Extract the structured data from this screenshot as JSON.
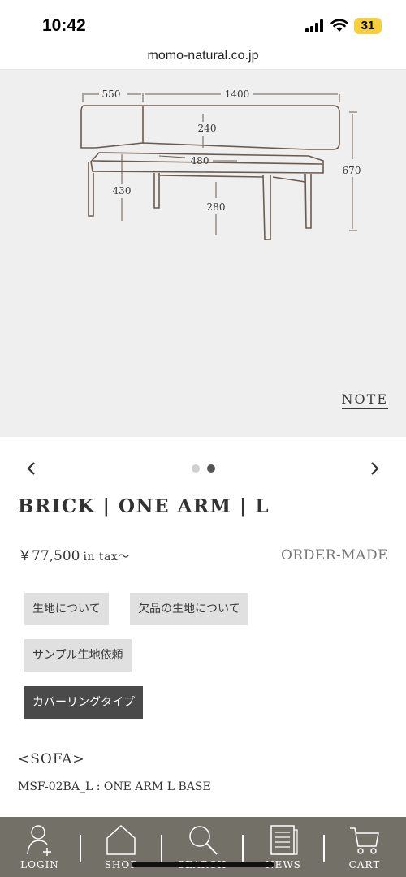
{
  "status": {
    "time": "10:42",
    "battery": "31"
  },
  "browser": {
    "url": "momo-natural.co.jp"
  },
  "dimensions": {
    "arm_width": "550",
    "total_width": "1400",
    "back_height": "240",
    "seat_depth": "480",
    "total_height": "670",
    "seat_height": "430",
    "leg_height": "280"
  },
  "note_link": "NOTE",
  "carousel": {
    "total_slides": 2,
    "active_slide": 2
  },
  "product": {
    "title": "BRICK | ONE ARM | L",
    "price": "￥77,500",
    "price_suffix": "in tax～",
    "order_type": "ORDER-MADE"
  },
  "buttons": {
    "fabric_info": "生地について",
    "missing_fabric": "欠品の生地について",
    "sample_request": "サンプル生地依頼",
    "covering_type": "カバーリングタイプ"
  },
  "section": {
    "heading": "<SOFA>",
    "model": "MSF-02BA_L : ONE ARM L BASE"
  },
  "nav": {
    "login": "LOGIN",
    "shop": "SHOP",
    "search": "SEARCH",
    "news": "NEWS",
    "cart": "CART"
  },
  "colors": {
    "nav_bg": "#737068",
    "image_bg": "#efefef",
    "dark_button": "#4a4a4a",
    "light_button": "#e0e0e0"
  }
}
